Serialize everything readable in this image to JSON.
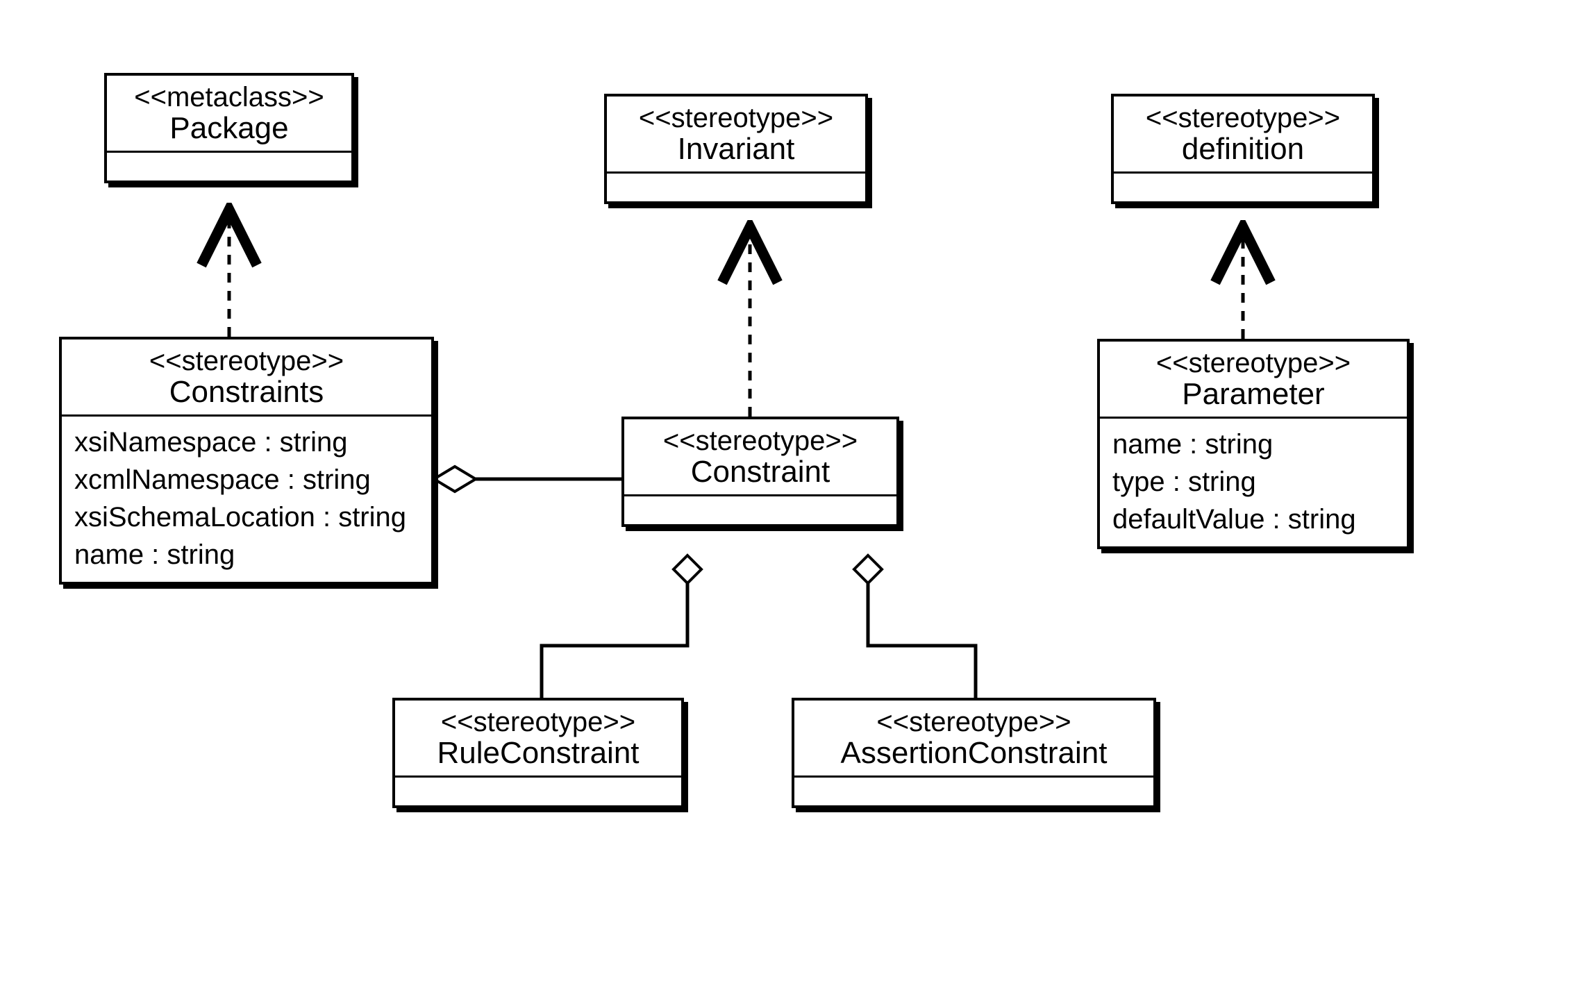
{
  "classes": {
    "package": {
      "stereotype": "<<metaclass>>",
      "name": "Package",
      "attributes": []
    },
    "constraints": {
      "stereotype": "<<stereotype>>",
      "name": "Constraints",
      "attributes": [
        "xsiNamespace : string",
        "xcmlNamespace : string",
        "xsiSchemaLocation : string",
        "name : string"
      ]
    },
    "invariant": {
      "stereotype": "<<stereotype>>",
      "name": "Invariant",
      "attributes": []
    },
    "constraint": {
      "stereotype": "<<stereotype>>",
      "name": "Constraint",
      "attributes": []
    },
    "ruleConstraint": {
      "stereotype": "<<stereotype>>",
      "name": "RuleConstraint",
      "attributes": []
    },
    "assertionConstraint": {
      "stereotype": "<<stereotype>>",
      "name": "AssertionConstraint",
      "attributes": []
    },
    "definition": {
      "stereotype": "<<stereotype>>",
      "name": "definition",
      "attributes": []
    },
    "parameter": {
      "stereotype": "<<stereotype>>",
      "name": "Parameter",
      "attributes": [
        "name : string",
        "type : string",
        "defaultValue : string"
      ]
    }
  },
  "relations": [
    {
      "from": "constraints",
      "to": "package",
      "kind": "realization"
    },
    {
      "from": "constraint",
      "to": "invariant",
      "kind": "realization"
    },
    {
      "from": "parameter",
      "to": "definition",
      "kind": "realization"
    },
    {
      "from": "constraints",
      "to": "constraint",
      "kind": "aggregation"
    },
    {
      "from": "constraint",
      "to": "ruleConstraint",
      "kind": "aggregation"
    },
    {
      "from": "constraint",
      "to": "assertionConstraint",
      "kind": "aggregation"
    }
  ]
}
